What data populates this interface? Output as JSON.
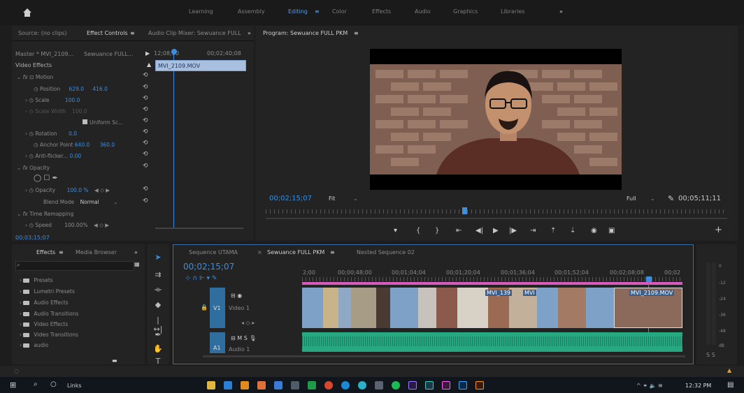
{
  "workspaces": {
    "items": [
      "Learning",
      "Assembly",
      "Editing",
      "Color",
      "Effects",
      "Audio",
      "Graphics",
      "Libraries"
    ],
    "active": "Editing",
    "overflow": "»"
  },
  "source_panel": {
    "tabs": [
      "Source: (no clips)",
      "Effect Controls",
      "Audio Clip Mixer: Sewuance FULL"
    ],
    "active_tab": "Effect Controls",
    "master": "Master * MVI_2109...",
    "sequence": "Sewuance FULL...",
    "timecode_start": "12;08;00",
    "timecode_end": "00;02;40;08",
    "clip_name": "MVI_2109.MOV",
    "section": "Video Effects",
    "current_time": "00;03;15;07"
  },
  "effects": [
    {
      "label": "Motion",
      "value": "",
      "value2": ""
    },
    {
      "label": "Position",
      "value": "629.0",
      "value2": "416.0"
    },
    {
      "label": "Scale",
      "value": "100.0",
      "value2": ""
    },
    {
      "label": "Scale Width",
      "value": "100.0",
      "value2": ""
    },
    {
      "label": "Uniform Sc...",
      "value": "",
      "value2": ""
    },
    {
      "label": "Rotation",
      "value": "0.0",
      "value2": ""
    },
    {
      "label": "Anchor Point",
      "value": "640.0",
      "value2": "360.0"
    },
    {
      "label": "Anti-flicker...",
      "value": "0.00",
      "value2": ""
    },
    {
      "label": "Opacity",
      "value": "",
      "value2": ""
    },
    {
      "label": "Opacity",
      "value": "100.0 %",
      "value2": ""
    },
    {
      "label": "Blend Mode",
      "value": "Normal",
      "value2": ""
    },
    {
      "label": "Time Remapping",
      "value": "",
      "value2": ""
    },
    {
      "label": "Speed",
      "value": "100.00%",
      "value2": ""
    }
  ],
  "program": {
    "title": "Program: Sewuance FULL PKM",
    "timecode": "00;02;15;07",
    "fit": "Fit",
    "quality": "Full",
    "duration": "00;05;11;11"
  },
  "effects_panel": {
    "tabs": [
      "Effects",
      "Media Browser"
    ],
    "folders": [
      "Presets",
      "Lumetri Presets",
      "Audio Effects",
      "Audio Transitions",
      "Video Effects",
      "Video Transitions",
      "audio"
    ]
  },
  "timeline": {
    "tabs": [
      "Sequence UTAMA",
      "Sewuance FULL PKM",
      "Nested Sequence 02"
    ],
    "active_tab": "Sewuance FULL PKM",
    "timecode": "00;02;15;07",
    "ruler": [
      "2;00",
      "00;00;48;00",
      "00;01;04;04",
      "00;01;20;04",
      "00;01;36;04",
      "00;01;52;04",
      "00;02;08;08",
      "00;02"
    ],
    "tracks": {
      "v1": "V1",
      "video_label": "Video 1",
      "a1": "A1",
      "audio_label": "Audio 1"
    },
    "clip_labels": [
      "MVI_139",
      "MVI",
      "MVI_2109.MOV"
    ]
  },
  "meter": {
    "labels": [
      "0",
      "-12",
      "-24",
      "-36",
      "-48",
      "dB"
    ],
    "solo": "S S"
  },
  "taskbar": {
    "search": "Links",
    "time": "12:32 PM"
  }
}
